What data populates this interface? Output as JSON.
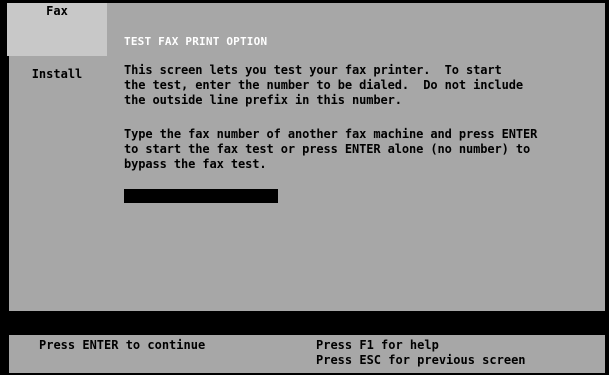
{
  "sidebar": {
    "items": [
      {
        "label": "Fax",
        "active": true
      },
      {
        "label": "Install",
        "active": false
      }
    ]
  },
  "main": {
    "title": "TEST FAX PRINT OPTION",
    "paragraph1": [
      "This screen lets you test your fax printer.  To start",
      "the test, enter the number to be dialed.  Do not include",
      "the outside line prefix in this number."
    ],
    "paragraph2": [
      "Type the fax number of another fax machine and press ENTER",
      "to start the fax test or press ENTER alone (no number) to",
      "bypass the fax test."
    ],
    "fax_number_value": ""
  },
  "status": {
    "left": "Press ENTER to continue",
    "right_line1": "Press F1 for help",
    "right_line2": "Press ESC for previous screen"
  },
  "colors": {
    "panel": "#a7a7a7",
    "active_tab": "#c8c8c8",
    "title": "#ffffff",
    "input": "#000000"
  }
}
